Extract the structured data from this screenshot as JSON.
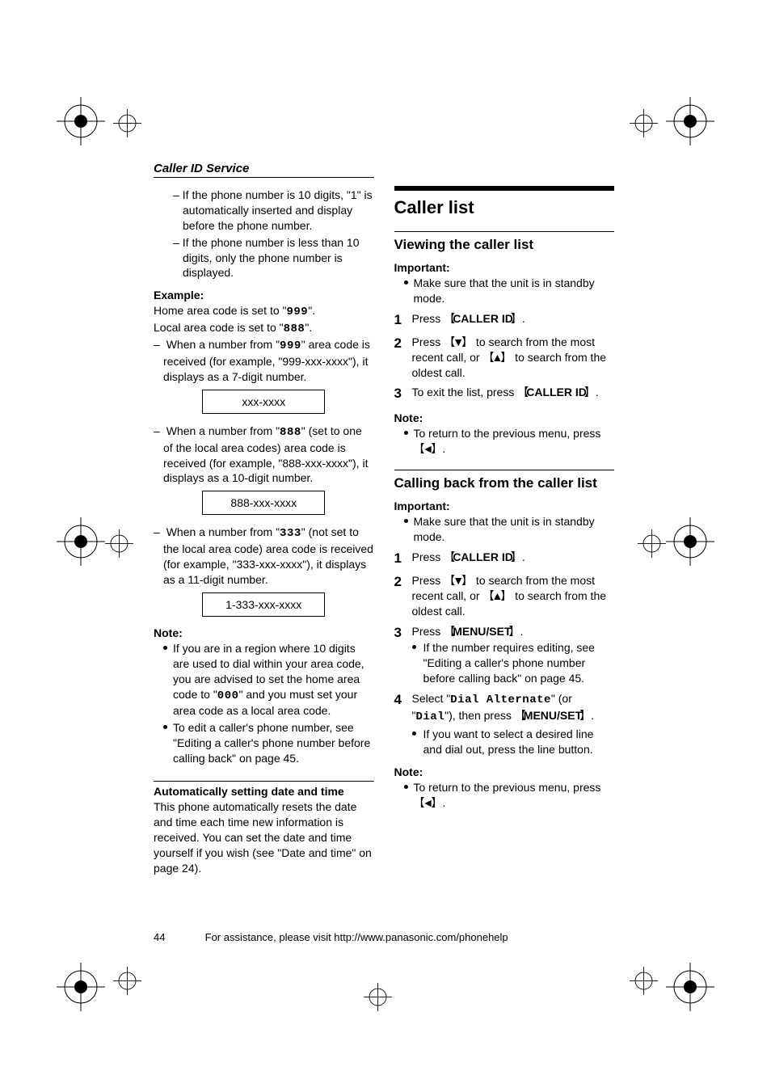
{
  "header": {
    "section": "Caller ID Service"
  },
  "left": {
    "cont_a": "If the phone number is 10 digits, \"1\" is automatically inserted and display before the phone number.",
    "cont_b": "If the phone number is less than 10 digits, only the phone number is displayed.",
    "example_label": "Example:",
    "ex_line1_a": "Home area code is set to \"",
    "ex_line1_code": "999",
    "ex_line1_b": "\".",
    "ex_line2_a": "Local area code is set to \"",
    "ex_line2_code": "888",
    "ex_line2_b": "\".",
    "case1_a": "When a number from \"",
    "case1_code": "999",
    "case1_b": "\" area code is received (for example, \"999-xxx-xxxx\"), it displays as a 7-digit number.",
    "box1": "xxx-xxxx",
    "case2_a": "When a number from \"",
    "case2_code": "888",
    "case2_b": "\" (set to one of the local area codes) area code is received (for example, \"888-xxx-xxxx\"), it displays as a 10-digit number.",
    "box2": "888-xxx-xxxx",
    "case3_a": "When a number from \"",
    "case3_code": "333",
    "case3_b": "\" (not set to the local area code) area code is received (for example, \"333-xxx-xxxx\"), it displays as a 11-digit number.",
    "box3": "1-333-xxx-xxxx",
    "note_label": "Note:",
    "note1_a": "If you are in a region where 10 digits are used to dial within your area code, you are advised to set the home area code to \"",
    "note1_code": "000",
    "note1_b": "\" and you must set your area code as a local area code.",
    "note2": "To edit a caller's phone number, see \"Editing a caller's phone number before calling back\" on page 45.",
    "auto_heading": "Automatically setting date and time",
    "auto_body": "This phone automatically resets the date and time each time new information is received. You can set the date and time yourself if you wish (see \"Date and time\" on page 24)."
  },
  "right": {
    "main": "Caller list",
    "view_heading": "Viewing the caller list",
    "important_label": "Important:",
    "important_text": "Make sure that the unit is in standby mode.",
    "step1_a": "Press ",
    "key_callerid": "CALLER ID",
    "step1_b": ".",
    "step2_a": "Press ",
    "step2_b": " to search from the most recent call, or ",
    "step2_c": " to search from the oldest call.",
    "step3_a": "To exit the list, press ",
    "step3_b": ".",
    "note_label": "Note:",
    "note_return_a": "To return to the previous menu, press ",
    "note_return_b": ".",
    "call_heading": "Calling back from the caller list",
    "c_step3_a": "Press ",
    "key_menuset": "MENU/SET",
    "c_step3_b": ".",
    "c_step3_bullet": "If the number requires editing, see \"Editing a caller's phone number before calling back\" on page 45.",
    "c_step4_a": "Select \"",
    "c_step4_code1": "Dial Alternate",
    "c_step4_b": "\" (or \"",
    "c_step4_code2": "Dial",
    "c_step4_c": "\"), then press ",
    "c_step4_d": ".",
    "c_step4_bullet": "If you want to select a desired line and dial out, press the line button."
  },
  "footer": {
    "page": "44",
    "text": "For assistance, please visit http://www.panasonic.com/phonehelp"
  }
}
